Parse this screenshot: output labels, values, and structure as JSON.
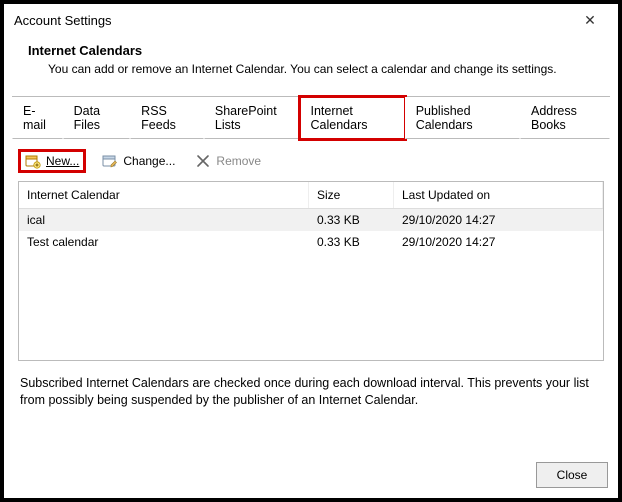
{
  "window": {
    "title": "Account Settings",
    "close_glyph": "✕"
  },
  "header": {
    "title": "Internet Calendars",
    "description": "You can add or remove an Internet Calendar. You can select a calendar and change its settings."
  },
  "tabs": [
    {
      "label": "E-mail",
      "active": false
    },
    {
      "label": "Data Files",
      "active": false
    },
    {
      "label": "RSS Feeds",
      "active": false
    },
    {
      "label": "SharePoint Lists",
      "active": false
    },
    {
      "label": "Internet Calendars",
      "active": true
    },
    {
      "label": "Published Calendars",
      "active": false
    },
    {
      "label": "Address Books",
      "active": false
    }
  ],
  "toolbar": {
    "new_label": "New...",
    "change_label": "Change...",
    "remove_label": "Remove"
  },
  "grid": {
    "columns": {
      "name": "Internet Calendar",
      "size": "Size",
      "updated": "Last Updated on"
    },
    "rows": [
      {
        "name": "ical",
        "size": "0.33 KB",
        "updated": "29/10/2020 14:27",
        "selected": true
      },
      {
        "name": "Test calendar",
        "size": "0.33 KB",
        "updated": "29/10/2020 14:27",
        "selected": false
      }
    ]
  },
  "note": "Subscribed Internet Calendars are checked once during each download interval. This prevents your list from possibly being suspended by the publisher of an Internet Calendar.",
  "footer": {
    "close_label": "Close"
  },
  "highlight": {
    "tab_index": 4
  }
}
